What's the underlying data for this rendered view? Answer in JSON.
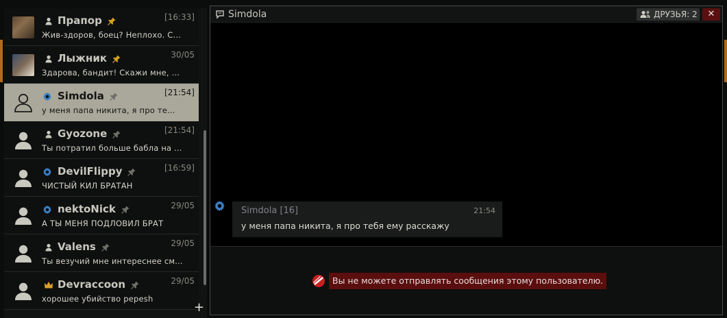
{
  "dialogs": [
    {
      "name": "Прапор",
      "time": "[16:33]",
      "last": "Жив-здоров, боец? Неплохо. С...",
      "icon": "user-icon",
      "pinned": true,
      "avatar": "photo1"
    },
    {
      "name": "Лыжник",
      "time": "30/05",
      "last": "Здарова, бандит! Скажи мне, ...",
      "icon": "user-icon",
      "pinned": true,
      "avatar": "photo2"
    },
    {
      "name": "Simdola",
      "time": "[21:54]",
      "last": "у меня папа никита, я про те...",
      "icon": "gear-icon",
      "pinned": false,
      "selected": true
    },
    {
      "name": "Gyozone",
      "time": "[21:54]",
      "last": "Ты потратил больше бабла на ...",
      "icon": "user-icon",
      "pinned": false
    },
    {
      "name": "DevilFlippy",
      "time": "[16:59]",
      "last": "ЧИСТЫЙ КИЛ БРАТАН",
      "icon": "gear-icon",
      "pinned": false
    },
    {
      "name": "nektoNick",
      "time": "29/05",
      "last": "А ТЫ МЕНЯ ПОДЛОВИЛ БРАТ",
      "icon": "gear-icon",
      "pinned": false
    },
    {
      "name": "Valens",
      "time": "29/05",
      "last": "Ты везучий мне интереснее см...",
      "icon": "user-icon",
      "pinned": false
    },
    {
      "name": "Devraccoon",
      "time": "29/05",
      "last": "хорошее убийство pepesh",
      "icon": "crown-icon",
      "pinned": false
    }
  ],
  "chat": {
    "title": "Simdola",
    "friends_label": "ДРУЗЬЯ: 2",
    "close_label": "✕",
    "message": {
      "author": "Simdola [16]",
      "time": "21:54",
      "text": "у меня папа никита, я про тебя ему расскажу"
    },
    "blocked_notice": "Вы не можете отправлять сообщения этому пользователю."
  },
  "colors": {
    "selected_row": "#a9a89a",
    "gear_blue": "#3b7fc4",
    "pin_gold": "#d6a21c",
    "crown_gold": "#d8a32a",
    "notice_red": "#5b0e0e"
  },
  "add_label": "+"
}
